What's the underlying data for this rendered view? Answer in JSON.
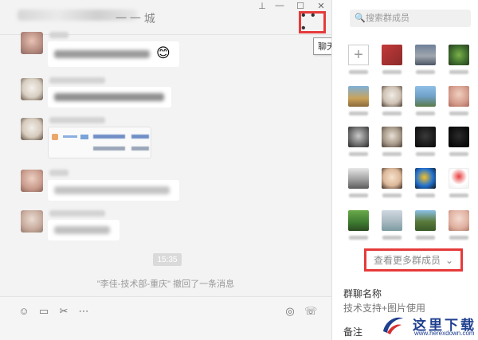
{
  "window": {
    "title": "一 一 城",
    "pin_glyph": "⊥",
    "minimize_glyph": "—",
    "maximize_glyph": "☐",
    "close_glyph": "✕"
  },
  "header": {
    "more_glyph": "• • •",
    "tooltip": "聊天信息"
  },
  "chat": {
    "time_divider": "15:35",
    "recall_notice": "\"李佳-技术部-重庆\" 撤回了一条消息",
    "emoji_glyph": "😊"
  },
  "input_bar": {
    "tools": [
      {
        "name": "emoji-icon",
        "glyph": "☺"
      },
      {
        "name": "folder-icon",
        "glyph": "▭"
      },
      {
        "name": "scissors-icon",
        "glyph": "✂"
      },
      {
        "name": "chat-bubble-icon",
        "glyph": "⋯"
      },
      {
        "name": "voice-call-icon",
        "glyph": "◎"
      },
      {
        "name": "phone-icon",
        "glyph": "☏"
      }
    ]
  },
  "panel": {
    "search_placeholder": "搜索群成员",
    "search_icon": "🔍",
    "add_member_glyph": "+",
    "more_members": "查看更多群成员",
    "more_members_chevron": "⌄",
    "group_name_label": "群聊名称",
    "group_name_value": "技术支持+图片使用",
    "remark_label": "备注"
  },
  "watermark": {
    "name": "这里下载",
    "url": "www.herexdown.com"
  },
  "colors": {
    "highlight": "#e63a3a",
    "chat_bg": "#f3f3f3",
    "logo_blue": "#1f3f8f"
  }
}
